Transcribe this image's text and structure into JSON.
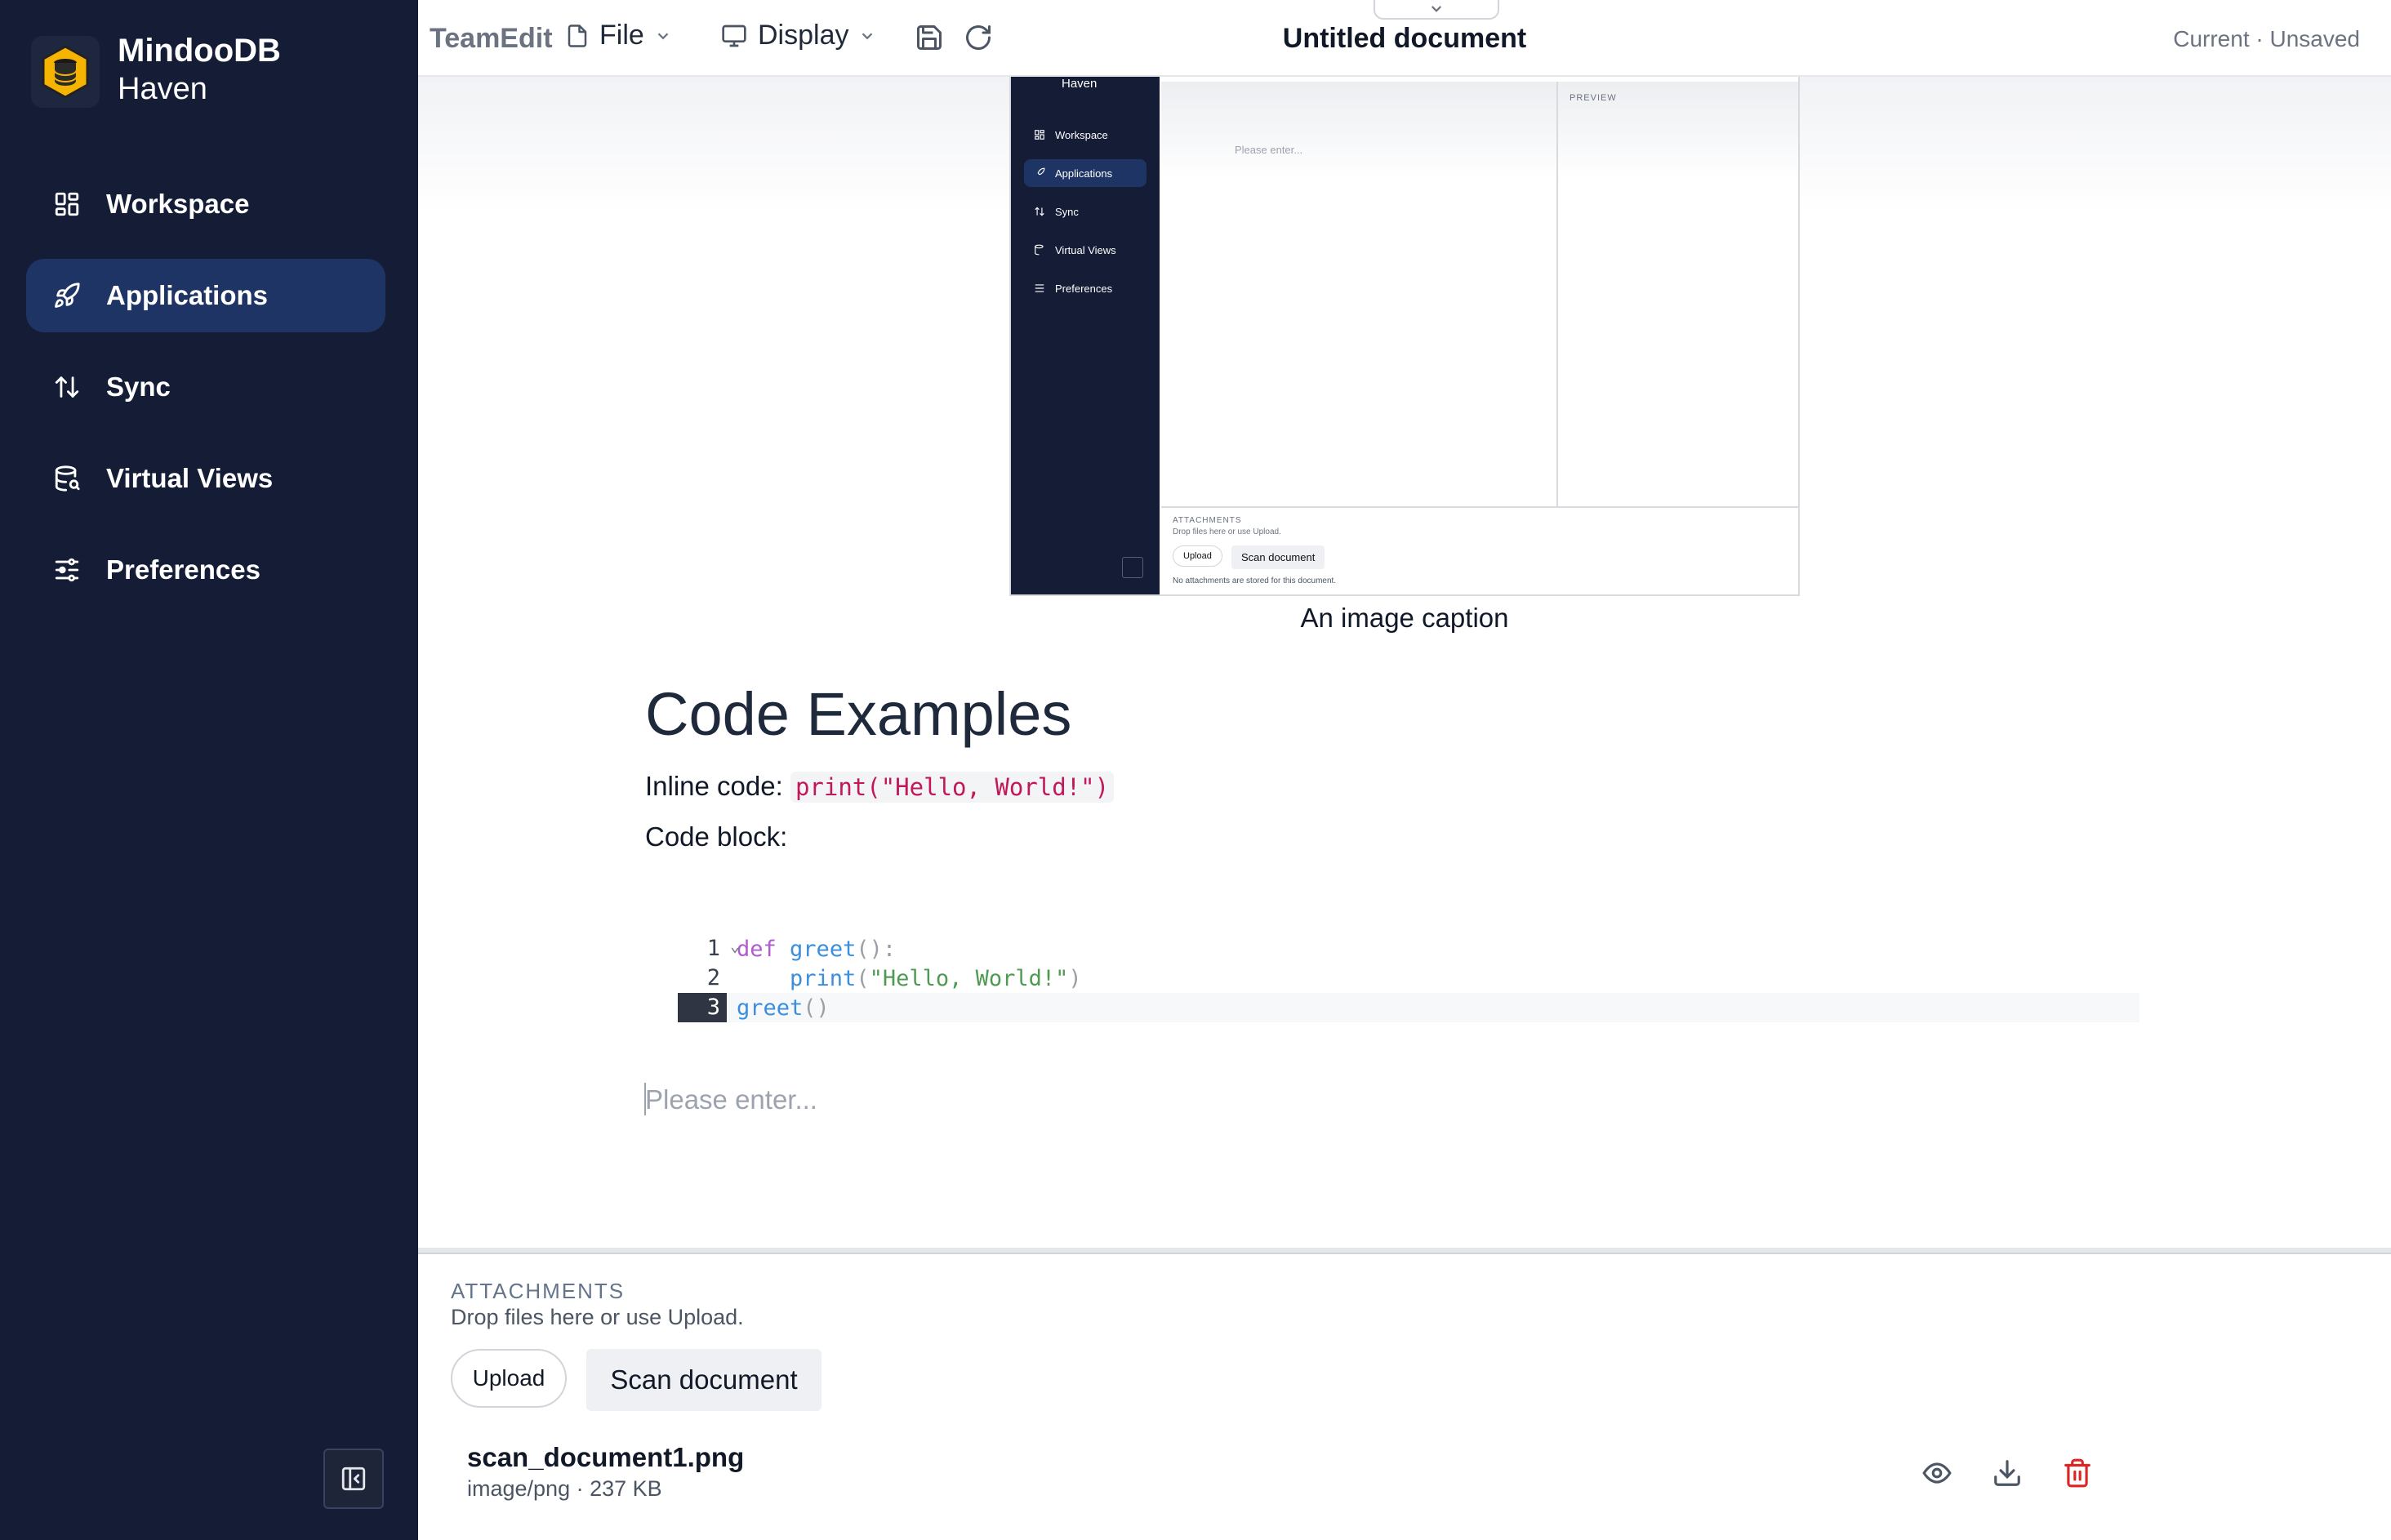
{
  "sidebar": {
    "brand_line1": "MindooDB",
    "brand_line2": "Haven",
    "items": [
      {
        "label": "Workspace",
        "icon": "grid-icon",
        "active": false
      },
      {
        "label": "Applications",
        "icon": "rocket-icon",
        "active": true
      },
      {
        "label": "Sync",
        "icon": "sync-arrows-icon",
        "active": false
      },
      {
        "label": "Virtual Views",
        "icon": "database-search-icon",
        "active": false
      },
      {
        "label": "Preferences",
        "icon": "sliders-icon",
        "active": false
      }
    ]
  },
  "toolbar": {
    "app_name": "TeamEdit",
    "file_menu": "File",
    "display_menu": "Display",
    "document_title": "Untitled document",
    "status": "Current · Unsaved"
  },
  "document": {
    "embedded_screenshot": {
      "brand": "Haven",
      "nav": [
        "Workspace",
        "Applications",
        "Sync",
        "Virtual Views",
        "Preferences"
      ],
      "editor_placeholder": "Please enter...",
      "preview_label": "PREVIEW",
      "attachments_label": "ATTACHMENTS",
      "attachments_hint": "Drop files here or use Upload.",
      "upload": "Upload",
      "scan": "Scan document",
      "empty_message": "No attachments are stored for this document."
    },
    "image_caption": "An image caption",
    "heading": "Code Examples",
    "inline_label": "Inline code: ",
    "inline_code": "print(\"Hello, World!\")",
    "block_label": "Code block:",
    "code_lines": [
      {
        "number": "1",
        "indent": "",
        "tokens": [
          {
            "t": "def",
            "c": "kw"
          },
          {
            "t": " ",
            "c": ""
          },
          {
            "t": "greet",
            "c": "fn"
          },
          {
            "t": "():",
            "c": "pn"
          }
        ]
      },
      {
        "number": "2",
        "indent": "    ",
        "tokens": [
          {
            "t": "print",
            "c": "fn"
          },
          {
            "t": "(",
            "c": "pn"
          },
          {
            "t": "\"Hello, World!\"",
            "c": "str"
          },
          {
            "t": ")",
            "c": "pn"
          }
        ]
      },
      {
        "number": "3",
        "indent": "",
        "tokens": [
          {
            "t": "greet",
            "c": "fn"
          },
          {
            "t": "()",
            "c": "pn"
          }
        ]
      }
    ],
    "placeholder": "Please enter..."
  },
  "attachments": {
    "title": "ATTACHMENTS",
    "hint": "Drop files here or use Upload.",
    "upload_label": "Upload",
    "scan_label": "Scan document",
    "files": [
      {
        "name": "scan_document1.png",
        "meta": "image/png · 237 KB"
      }
    ]
  },
  "colors": {
    "sidebar_bg": "#141c36",
    "active_item": "#1d3464",
    "delete_red": "#dc2626"
  }
}
